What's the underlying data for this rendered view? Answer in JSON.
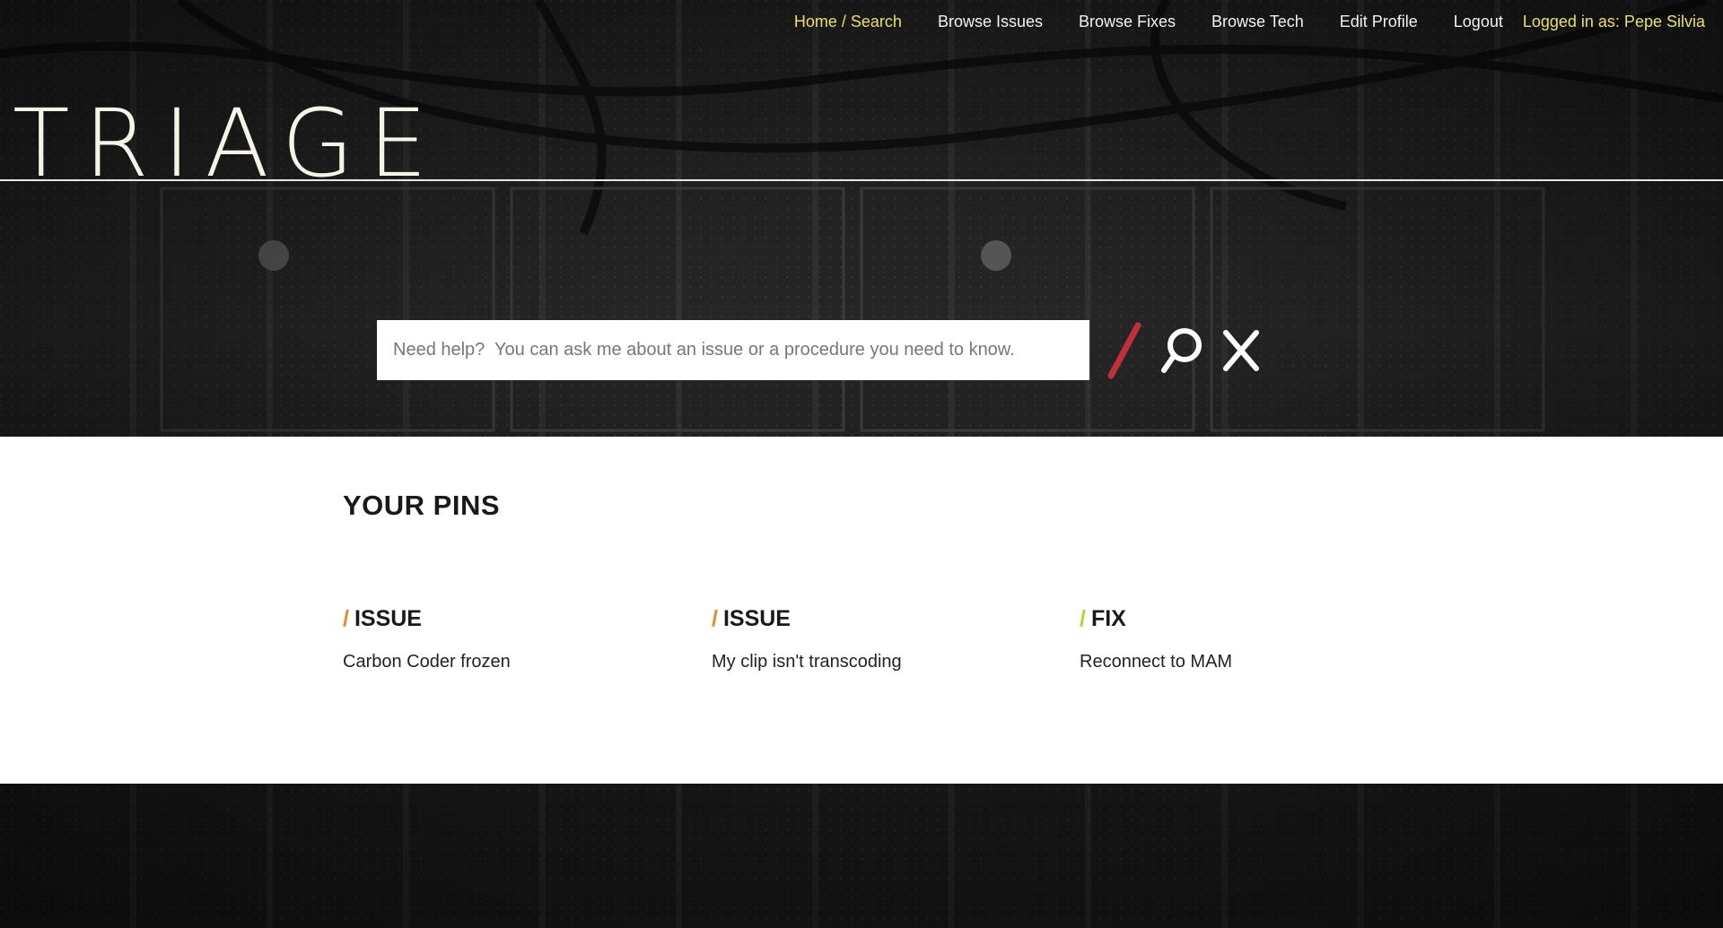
{
  "nav": {
    "items": [
      {
        "label": "Home / Search",
        "active": true
      },
      {
        "label": "Browse Issues",
        "active": false
      },
      {
        "label": "Browse Fixes",
        "active": false
      },
      {
        "label": "Browse Tech",
        "active": false
      },
      {
        "label": "Edit Profile",
        "active": false
      },
      {
        "label": "Logout",
        "active": false
      }
    ],
    "logged_in": "Logged in as: Pepe Silvia"
  },
  "logo": "TRIAGE",
  "search": {
    "placeholder": "Need help?  You can ask me about an issue or a procedure you need to know.",
    "value": "",
    "icons": [
      "slash-icon",
      "search-icon",
      "close-icon"
    ]
  },
  "pins": {
    "title": "YOUR PINS",
    "items": [
      {
        "type": "ISSUE",
        "title": "Carbon Coder frozen",
        "color": "#e8892b"
      },
      {
        "type": "ISSUE",
        "title": "My clip isn't transcoding",
        "color": "#e8892b"
      },
      {
        "type": "FIX",
        "title": "Reconnect to MAM",
        "color": "#b9cf2e"
      }
    ]
  },
  "colors": {
    "accent_yellow": "#e8e06a",
    "slash_red": "#c0303a",
    "issue_orange": "#e8892b",
    "fix_green": "#b9cf2e"
  }
}
